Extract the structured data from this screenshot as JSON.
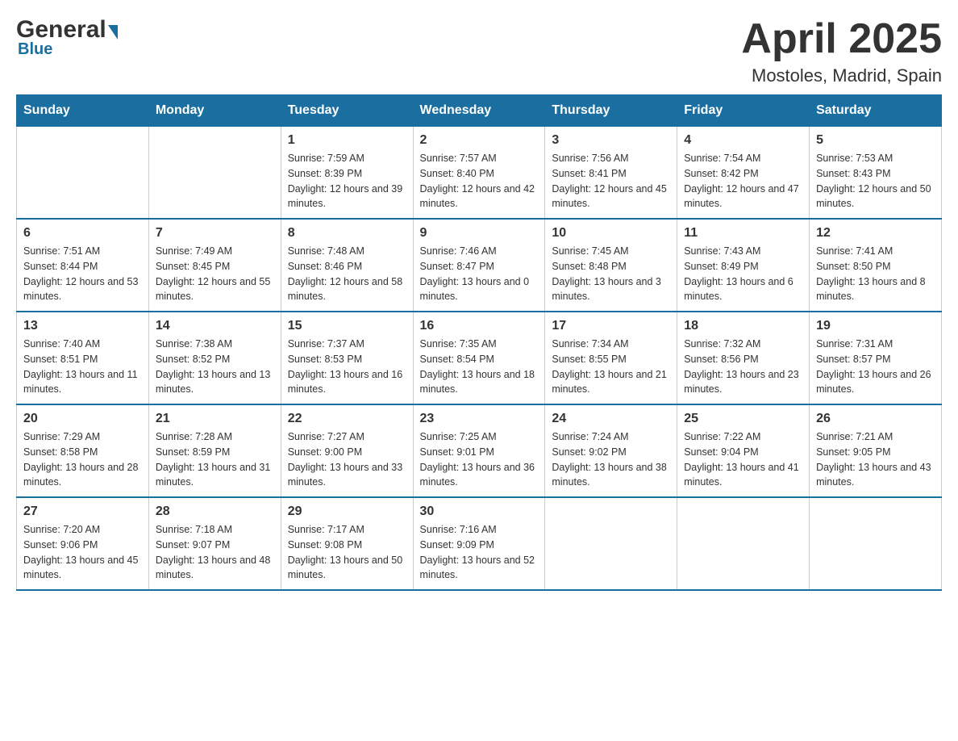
{
  "header": {
    "title": "April 2025",
    "subtitle": "Mostoles, Madrid, Spain",
    "logo_general": "General",
    "logo_blue": "Blue"
  },
  "weekdays": [
    "Sunday",
    "Monday",
    "Tuesday",
    "Wednesday",
    "Thursday",
    "Friday",
    "Saturday"
  ],
  "weeks": [
    [
      {
        "day": "",
        "sunrise": "",
        "sunset": "",
        "daylight": ""
      },
      {
        "day": "",
        "sunrise": "",
        "sunset": "",
        "daylight": ""
      },
      {
        "day": "1",
        "sunrise": "Sunrise: 7:59 AM",
        "sunset": "Sunset: 8:39 PM",
        "daylight": "Daylight: 12 hours and 39 minutes."
      },
      {
        "day": "2",
        "sunrise": "Sunrise: 7:57 AM",
        "sunset": "Sunset: 8:40 PM",
        "daylight": "Daylight: 12 hours and 42 minutes."
      },
      {
        "day": "3",
        "sunrise": "Sunrise: 7:56 AM",
        "sunset": "Sunset: 8:41 PM",
        "daylight": "Daylight: 12 hours and 45 minutes."
      },
      {
        "day": "4",
        "sunrise": "Sunrise: 7:54 AM",
        "sunset": "Sunset: 8:42 PM",
        "daylight": "Daylight: 12 hours and 47 minutes."
      },
      {
        "day": "5",
        "sunrise": "Sunrise: 7:53 AM",
        "sunset": "Sunset: 8:43 PM",
        "daylight": "Daylight: 12 hours and 50 minutes."
      }
    ],
    [
      {
        "day": "6",
        "sunrise": "Sunrise: 7:51 AM",
        "sunset": "Sunset: 8:44 PM",
        "daylight": "Daylight: 12 hours and 53 minutes."
      },
      {
        "day": "7",
        "sunrise": "Sunrise: 7:49 AM",
        "sunset": "Sunset: 8:45 PM",
        "daylight": "Daylight: 12 hours and 55 minutes."
      },
      {
        "day": "8",
        "sunrise": "Sunrise: 7:48 AM",
        "sunset": "Sunset: 8:46 PM",
        "daylight": "Daylight: 12 hours and 58 minutes."
      },
      {
        "day": "9",
        "sunrise": "Sunrise: 7:46 AM",
        "sunset": "Sunset: 8:47 PM",
        "daylight": "Daylight: 13 hours and 0 minutes."
      },
      {
        "day": "10",
        "sunrise": "Sunrise: 7:45 AM",
        "sunset": "Sunset: 8:48 PM",
        "daylight": "Daylight: 13 hours and 3 minutes."
      },
      {
        "day": "11",
        "sunrise": "Sunrise: 7:43 AM",
        "sunset": "Sunset: 8:49 PM",
        "daylight": "Daylight: 13 hours and 6 minutes."
      },
      {
        "day": "12",
        "sunrise": "Sunrise: 7:41 AM",
        "sunset": "Sunset: 8:50 PM",
        "daylight": "Daylight: 13 hours and 8 minutes."
      }
    ],
    [
      {
        "day": "13",
        "sunrise": "Sunrise: 7:40 AM",
        "sunset": "Sunset: 8:51 PM",
        "daylight": "Daylight: 13 hours and 11 minutes."
      },
      {
        "day": "14",
        "sunrise": "Sunrise: 7:38 AM",
        "sunset": "Sunset: 8:52 PM",
        "daylight": "Daylight: 13 hours and 13 minutes."
      },
      {
        "day": "15",
        "sunrise": "Sunrise: 7:37 AM",
        "sunset": "Sunset: 8:53 PM",
        "daylight": "Daylight: 13 hours and 16 minutes."
      },
      {
        "day": "16",
        "sunrise": "Sunrise: 7:35 AM",
        "sunset": "Sunset: 8:54 PM",
        "daylight": "Daylight: 13 hours and 18 minutes."
      },
      {
        "day": "17",
        "sunrise": "Sunrise: 7:34 AM",
        "sunset": "Sunset: 8:55 PM",
        "daylight": "Daylight: 13 hours and 21 minutes."
      },
      {
        "day": "18",
        "sunrise": "Sunrise: 7:32 AM",
        "sunset": "Sunset: 8:56 PM",
        "daylight": "Daylight: 13 hours and 23 minutes."
      },
      {
        "day": "19",
        "sunrise": "Sunrise: 7:31 AM",
        "sunset": "Sunset: 8:57 PM",
        "daylight": "Daylight: 13 hours and 26 minutes."
      }
    ],
    [
      {
        "day": "20",
        "sunrise": "Sunrise: 7:29 AM",
        "sunset": "Sunset: 8:58 PM",
        "daylight": "Daylight: 13 hours and 28 minutes."
      },
      {
        "day": "21",
        "sunrise": "Sunrise: 7:28 AM",
        "sunset": "Sunset: 8:59 PM",
        "daylight": "Daylight: 13 hours and 31 minutes."
      },
      {
        "day": "22",
        "sunrise": "Sunrise: 7:27 AM",
        "sunset": "Sunset: 9:00 PM",
        "daylight": "Daylight: 13 hours and 33 minutes."
      },
      {
        "day": "23",
        "sunrise": "Sunrise: 7:25 AM",
        "sunset": "Sunset: 9:01 PM",
        "daylight": "Daylight: 13 hours and 36 minutes."
      },
      {
        "day": "24",
        "sunrise": "Sunrise: 7:24 AM",
        "sunset": "Sunset: 9:02 PM",
        "daylight": "Daylight: 13 hours and 38 minutes."
      },
      {
        "day": "25",
        "sunrise": "Sunrise: 7:22 AM",
        "sunset": "Sunset: 9:04 PM",
        "daylight": "Daylight: 13 hours and 41 minutes."
      },
      {
        "day": "26",
        "sunrise": "Sunrise: 7:21 AM",
        "sunset": "Sunset: 9:05 PM",
        "daylight": "Daylight: 13 hours and 43 minutes."
      }
    ],
    [
      {
        "day": "27",
        "sunrise": "Sunrise: 7:20 AM",
        "sunset": "Sunset: 9:06 PM",
        "daylight": "Daylight: 13 hours and 45 minutes."
      },
      {
        "day": "28",
        "sunrise": "Sunrise: 7:18 AM",
        "sunset": "Sunset: 9:07 PM",
        "daylight": "Daylight: 13 hours and 48 minutes."
      },
      {
        "day": "29",
        "sunrise": "Sunrise: 7:17 AM",
        "sunset": "Sunset: 9:08 PM",
        "daylight": "Daylight: 13 hours and 50 minutes."
      },
      {
        "day": "30",
        "sunrise": "Sunrise: 7:16 AM",
        "sunset": "Sunset: 9:09 PM",
        "daylight": "Daylight: 13 hours and 52 minutes."
      },
      {
        "day": "",
        "sunrise": "",
        "sunset": "",
        "daylight": ""
      },
      {
        "day": "",
        "sunrise": "",
        "sunset": "",
        "daylight": ""
      },
      {
        "day": "",
        "sunrise": "",
        "sunset": "",
        "daylight": ""
      }
    ]
  ]
}
